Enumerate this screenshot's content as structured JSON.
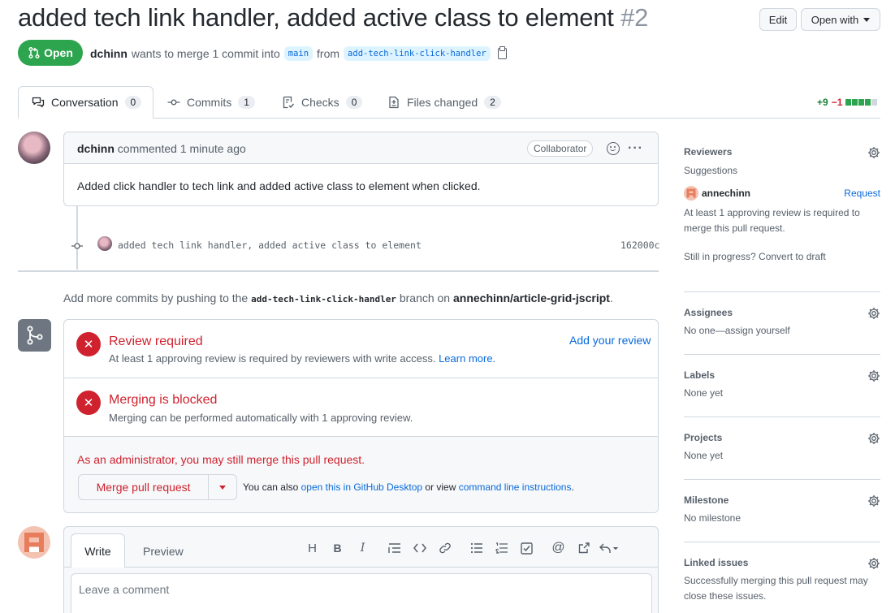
{
  "header": {
    "title": "added tech link handler, added active class to element",
    "number": "#2",
    "edit_label": "Edit",
    "open_with_label": "Open with",
    "state_label": "Open",
    "author": "dchinn",
    "merge_text": "wants to merge 1 commit into",
    "base_branch": "main",
    "from_text": "from",
    "head_branch": "add-tech-link-click-handler"
  },
  "tabs": [
    {
      "label": "Conversation",
      "count": "0"
    },
    {
      "label": "Commits",
      "count": "1"
    },
    {
      "label": "Checks",
      "count": "0"
    },
    {
      "label": "Files changed",
      "count": "2"
    }
  ],
  "diffstat": {
    "additions": "+9",
    "deletions": "−1"
  },
  "comment": {
    "author": "dchinn",
    "action": "commented",
    "time": "1 minute ago",
    "badge": "Collaborator",
    "body": "Added click handler to tech link and added active class to element when clicked."
  },
  "commit": {
    "message": "added tech link handler, added active class to element",
    "sha": "162000c"
  },
  "push_note": {
    "prefix": "Add more commits by pushing to the",
    "branch": "add-tech-link-click-handler",
    "middle": "branch on",
    "repo": "annechinn/article-grid-jscript",
    "suffix": "."
  },
  "merge": {
    "review_title": "Review required",
    "review_sub": "At least 1 approving review is required by reviewers with write access.",
    "learn_more": "Learn more.",
    "add_review": "Add your review",
    "blocked_title": "Merging is blocked",
    "blocked_sub": "Merging can be performed automatically with 1 approving review.",
    "admin_note": "As an administrator, you may still merge this pull request.",
    "merge_button": "Merge pull request",
    "alt_prefix": "You can also",
    "alt_desktop": "open this in GitHub Desktop",
    "alt_middle": "or view",
    "alt_cli": "command line instructions",
    "alt_suffix": "."
  },
  "composer": {
    "write_tab": "Write",
    "preview_tab": "Preview",
    "placeholder": "Leave a comment"
  },
  "sidebar": {
    "reviewers": {
      "title": "Reviewers",
      "suggestions": "Suggestions",
      "suggested_user": "annechinn",
      "request": "Request",
      "note": "At least 1 approving review is required to merge this pull request.",
      "draft": "Still in progress? Convert to draft"
    },
    "assignees": {
      "title": "Assignees",
      "value": "No one—assign yourself"
    },
    "labels": {
      "title": "Labels",
      "value": "None yet"
    },
    "projects": {
      "title": "Projects",
      "value": "None yet"
    },
    "milestone": {
      "title": "Milestone",
      "value": "No milestone"
    },
    "linked": {
      "title": "Linked issues",
      "value": "Successfully merging this pull request may close these issues."
    }
  },
  "colors": {
    "open_green": "#2da44e",
    "danger_red": "#cf222e",
    "link_blue": "#0969da"
  }
}
